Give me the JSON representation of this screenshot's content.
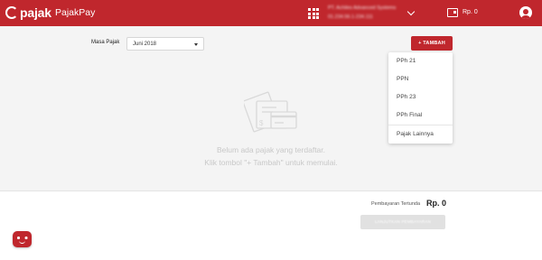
{
  "header": {
    "logo_text": "pajak",
    "app_name": "PajakPay",
    "company_name": "PT. Achiles Advanced Systems",
    "company_npwp": "01.234.56.1-234.111",
    "balance": "Rp. 0",
    "icons": [
      "pajak-logo-icon",
      "apps-grid-icon",
      "chevron-down-icon",
      "wallet-icon",
      "user-avatar-icon"
    ]
  },
  "period": {
    "label": "Masa Pajak",
    "selected": "Juni 2018"
  },
  "add_button": {
    "label": "+ TAMBAH"
  },
  "tax_menu": {
    "items": [
      "PPh 21",
      "PPN",
      "PPh 23",
      "PPh Final",
      "Pajak Lainnya"
    ]
  },
  "empty_state": {
    "line1": "Belum ada pajak yang terdaftar.",
    "line2": "Klik tombol \"+ Tambah\" untuk memulai."
  },
  "footer": {
    "total_label": "Pembayaran Tertunda",
    "total_value": "Rp. 0",
    "continue_label": "LANJUTKAN PEMBAYARAN"
  },
  "colors": {
    "brand": "#c0272d",
    "background": "#f4f4f4",
    "disabled": "#e1e1e1"
  }
}
